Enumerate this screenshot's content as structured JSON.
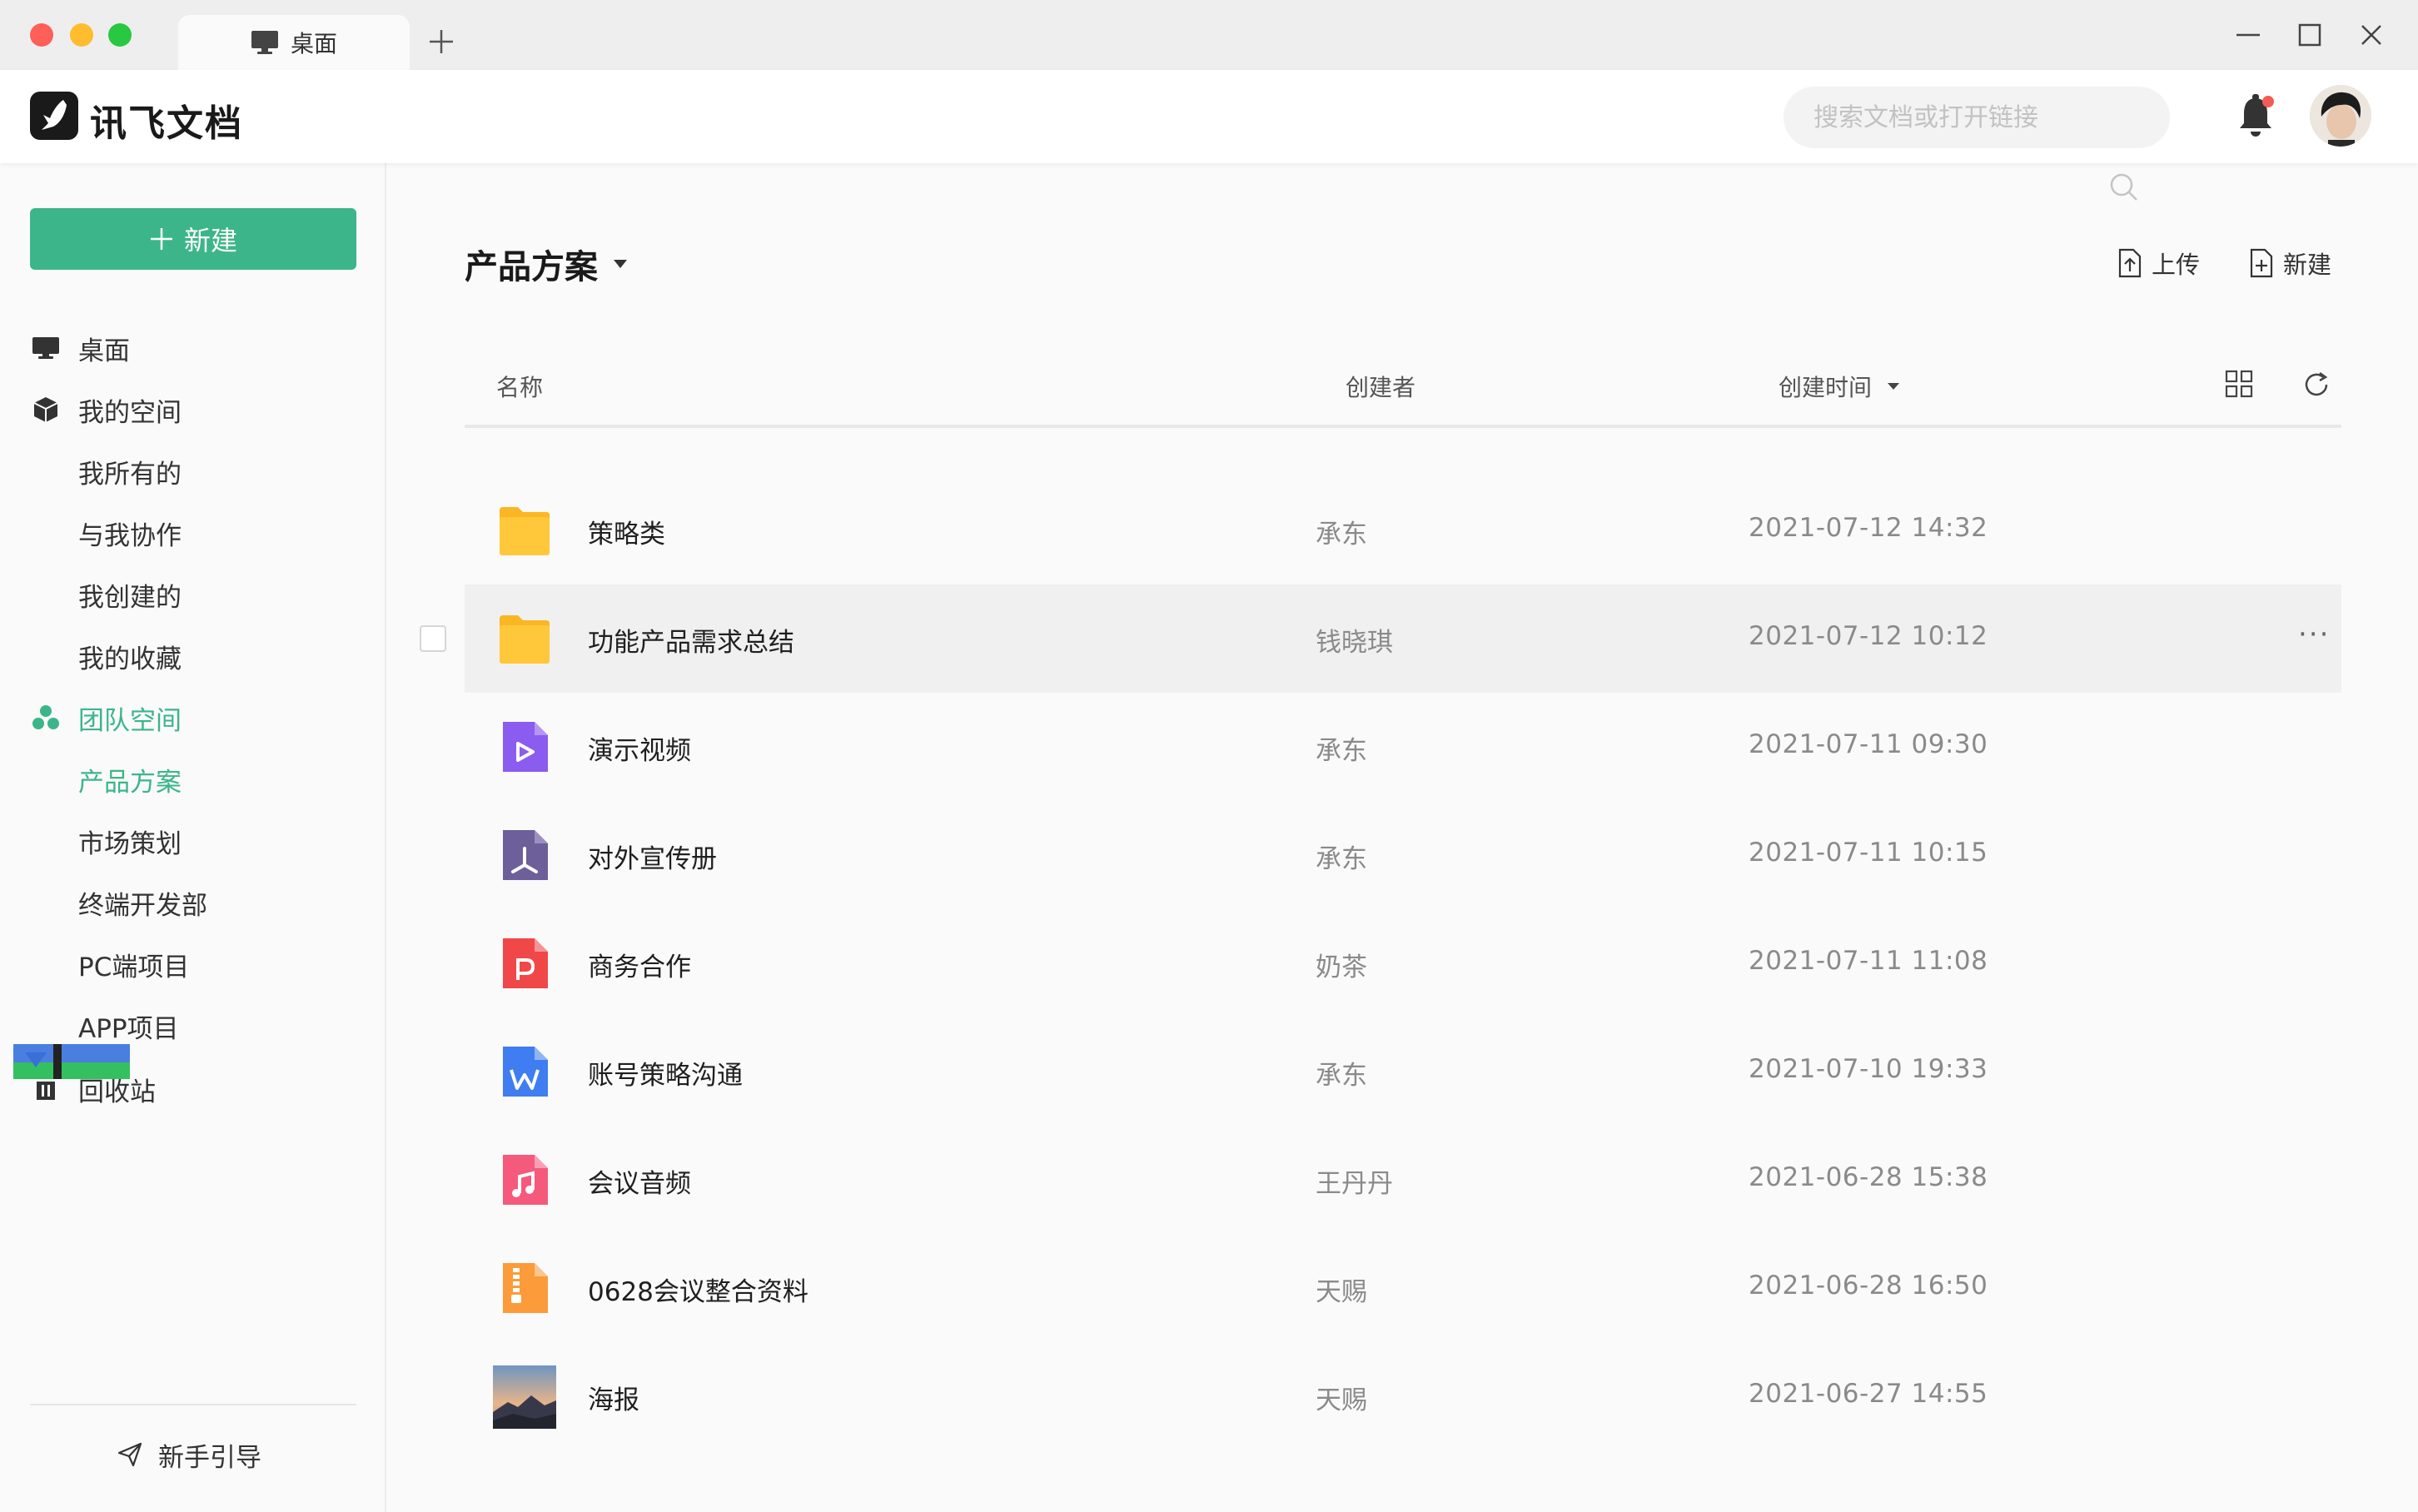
{
  "window": {
    "tab_label": "桌面",
    "colors": {
      "close": "#fe5f57",
      "minimize": "#febc2e",
      "zoom": "#28c840"
    }
  },
  "header": {
    "app_name": "讯飞文档",
    "search_placeholder": "搜索文档或打开链接",
    "accent": "#3cb58a"
  },
  "sidebar": {
    "new_button": "新建",
    "items": [
      {
        "label": "桌面",
        "icon": "desktop-icon"
      },
      {
        "label": "我的空间",
        "icon": "cube-icon"
      },
      {
        "label": "我所有的"
      },
      {
        "label": "与我协作"
      },
      {
        "label": "我创建的"
      },
      {
        "label": "我的收藏"
      },
      {
        "label": "团队空间",
        "icon": "team-icon"
      },
      {
        "label": "产品方案"
      },
      {
        "label": "市场策划"
      },
      {
        "label": "终端开发部"
      },
      {
        "label": "PC端项目"
      },
      {
        "label": "APP项目"
      },
      {
        "label": "回收站",
        "icon": "trash-icon"
      }
    ],
    "guide": "新手引导"
  },
  "main": {
    "title": "产品方案",
    "upload": "上传",
    "new": "新建",
    "columns": {
      "name": "名称",
      "creator": "创建者",
      "created": "创建时间"
    },
    "rows": [
      {
        "name": "策略类",
        "creator": "承东",
        "time": "2021-07-12  14:32",
        "type": "folder"
      },
      {
        "name": "功能产品需求总结",
        "creator": "钱晓琪",
        "time": "2021-07-12  10:12",
        "type": "folder",
        "more": "···"
      },
      {
        "name": "演示视频",
        "creator": "承东",
        "time": "2021-07-11  09:30",
        "type": "video"
      },
      {
        "name": "对外宣传册",
        "creator": "承东",
        "time": "2021-07-11  10:15",
        "type": "pdf"
      },
      {
        "name": "商务合作",
        "creator": "奶茶",
        "time": "2021-07-11  11:08",
        "type": "ppt"
      },
      {
        "name": "账号策略沟通",
        "creator": "承东",
        "time": "2021-07-10  19:33",
        "type": "word"
      },
      {
        "name": "会议音频",
        "creator": "王丹丹",
        "time": "2021-06-28 15:38",
        "type": "audio"
      },
      {
        "name": "0628会议整合资料",
        "creator": "天赐",
        "time": "2021-06-28  16:50",
        "type": "zip"
      },
      {
        "name": "海报",
        "creator": "天赐",
        "time": "2021-06-27  14:55",
        "type": "image"
      }
    ]
  }
}
